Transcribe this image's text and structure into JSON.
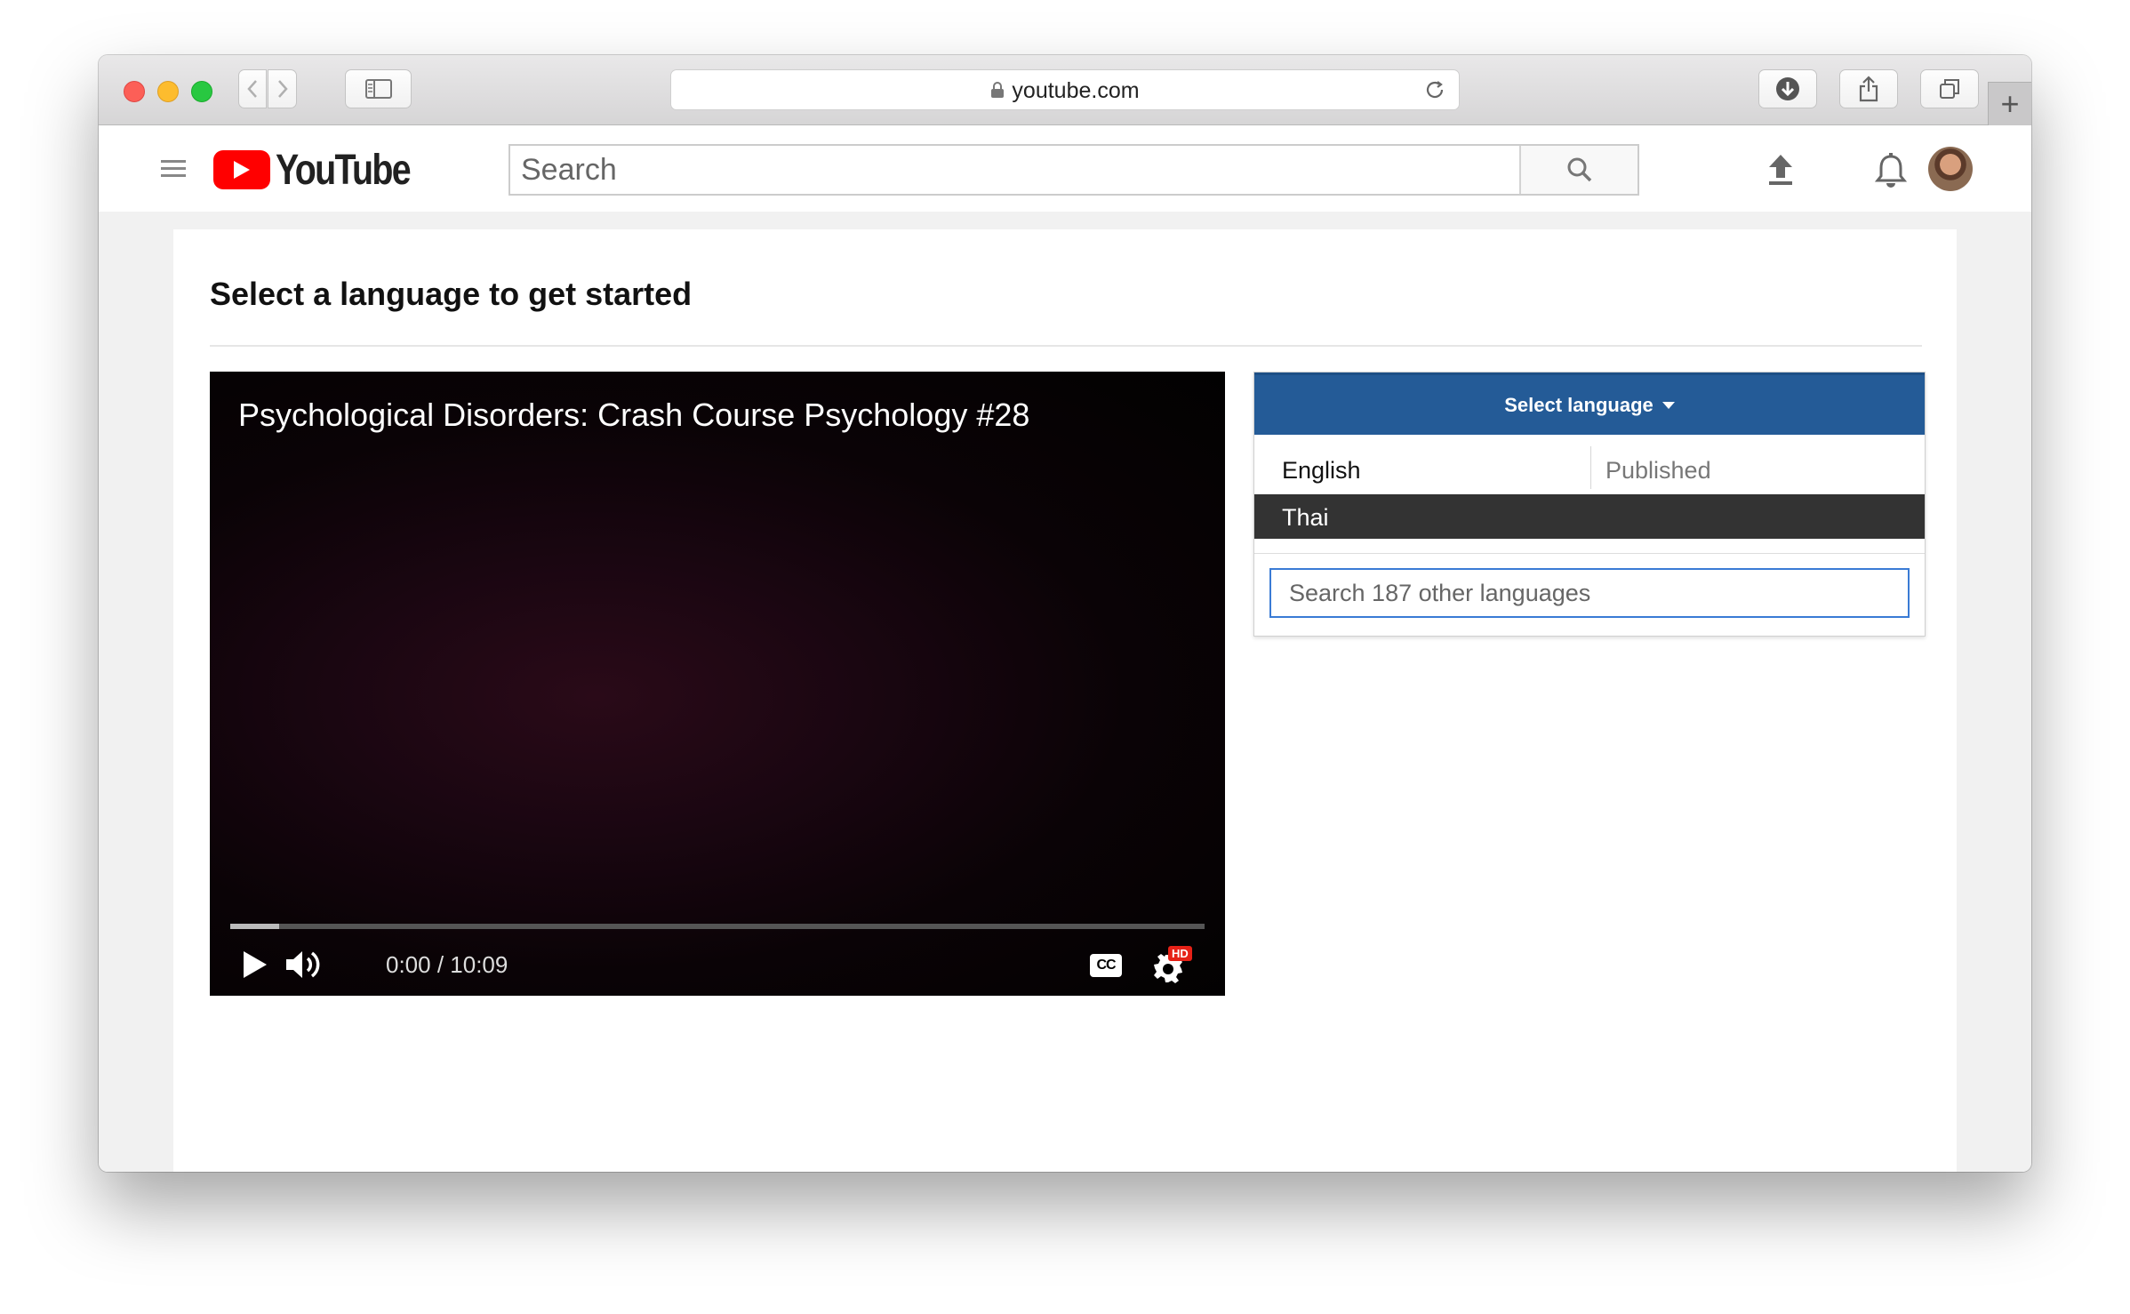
{
  "browser": {
    "url": "youtube.com",
    "new_tab_label": "+"
  },
  "youtube": {
    "logo_text": "YouTube",
    "search_placeholder": "Search",
    "icons": {
      "menu": "hamburger-icon",
      "search": "search-icon",
      "upload": "upload-icon",
      "notifications": "bell-icon",
      "avatar": "avatar"
    }
  },
  "page": {
    "heading": "Select a language to get started"
  },
  "player": {
    "title": "Psychological Disorders: Crash Course Psychology #28",
    "time": "0:00 / 10:09",
    "progress_fraction": 0.05,
    "hd_badge": "HD",
    "cc_label": "CC"
  },
  "language_panel": {
    "header_label": "Select language",
    "languages": [
      {
        "name": "English",
        "status": "Published",
        "selected": false
      },
      {
        "name": "Thai",
        "status": "",
        "selected": true
      }
    ],
    "search_placeholder": "Search 187 other languages"
  },
  "colors": {
    "accent": "#245b97",
    "selected_row": "#333333",
    "youtube_red": "#ff0000"
  }
}
